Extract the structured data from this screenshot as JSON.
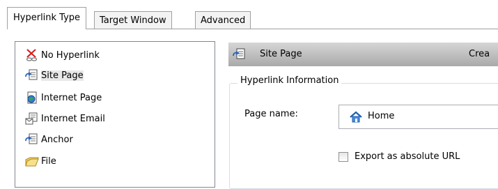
{
  "tabs": [
    {
      "label": "Hyperlink Type",
      "active": true
    },
    {
      "label": "Target Window",
      "active": false
    },
    {
      "label": "Advanced",
      "active": false
    }
  ],
  "link_types": [
    {
      "label": "No Hyperlink",
      "icon": "no-hyperlink-icon"
    },
    {
      "label": "Site Page",
      "icon": "site-page-icon",
      "selected": true
    },
    {
      "label": "Internet Page",
      "icon": "internet-page-icon"
    },
    {
      "label": "Internet Email",
      "icon": "internet-email-icon"
    },
    {
      "label": "Anchor",
      "icon": "anchor-icon"
    },
    {
      "label": "File",
      "icon": "file-icon"
    }
  ],
  "panel": {
    "header_title": "Site Page",
    "header_right": "Crea",
    "group_label": "Hyperlink Information",
    "page_name_label": "Page name:",
    "page_name_value": "Home",
    "export_label": "Export as absolute URL",
    "export_checked": false
  },
  "colors": {
    "header_top": "#d6d6d6",
    "header_bottom": "#a9a9a9",
    "border": "#a0a0a0",
    "selection": "#e8e8e8"
  }
}
